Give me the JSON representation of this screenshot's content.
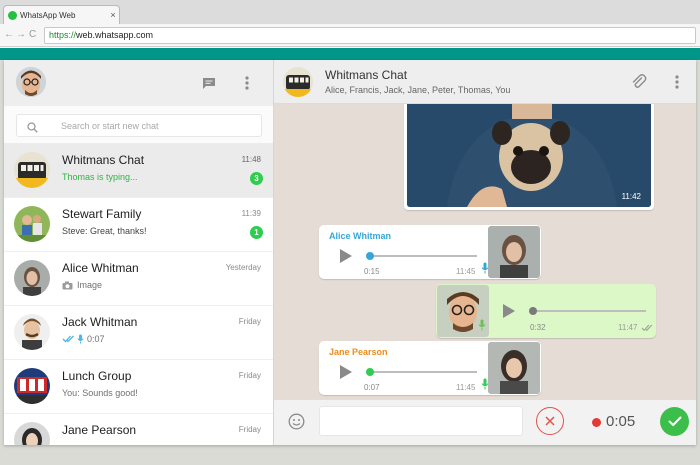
{
  "browser": {
    "tab_title": "WhatsApp Web",
    "tab_close": "×",
    "back": "←",
    "forward": "→",
    "reload": "C",
    "url_scheme": "https://",
    "url_rest": "web.whatsapp.com"
  },
  "search": {
    "placeholder": "Search or start new chat"
  },
  "chats": [
    {
      "name": "Whitmans Chat",
      "time": "11:48",
      "preview": "Thomas is typing...",
      "unread": "3"
    },
    {
      "name": "Stewart Family",
      "time": "11:39",
      "preview": "Steve: Great, thanks!",
      "unread": "1"
    },
    {
      "name": "Alice Whitman",
      "time": "Yesterday",
      "preview": "Image"
    },
    {
      "name": "Jack Whitman",
      "time": "Friday",
      "preview": "0:07"
    },
    {
      "name": "Lunch Group",
      "time": "Friday",
      "preview": "You: Sounds good!"
    },
    {
      "name": "Jane Pearson",
      "time": "Friday",
      "preview": ""
    }
  ],
  "conversation": {
    "title": "Whitmans Chat",
    "members": "Alice, Francis, Jack, Jane, Peter, Thomas, You"
  },
  "messages": {
    "photo_time": "11:42",
    "voice1": {
      "sender": "Alice Whitman",
      "duration": "0:15",
      "time": "11:45",
      "sender_color": "#35a7d6",
      "progress": 0
    },
    "voice2": {
      "duration": "0:32",
      "time": "11:47",
      "progress": 0
    },
    "voice3": {
      "sender": "Jane Pearson",
      "duration": "0:07",
      "time": "11:45",
      "sender_color": "#f08c1c",
      "progress": 0
    }
  },
  "composer": {
    "recording_time": "0:05"
  },
  "colors": {
    "accent": "#009688",
    "unread_badge": "#2ecc4f",
    "typing": "#2db742",
    "outgoing_bubble": "#dcf8c6",
    "record_dot": "#e53935",
    "send_button": "#3cbf4a"
  }
}
